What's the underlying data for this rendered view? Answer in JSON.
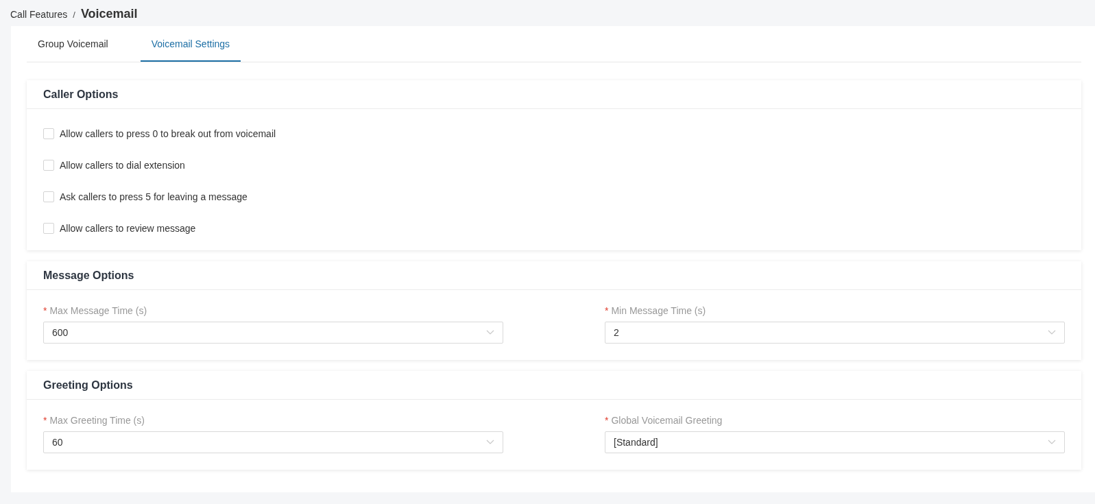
{
  "breadcrumb": {
    "parent": "Call Features",
    "separator": "/",
    "current": "Voicemail"
  },
  "tabs": [
    {
      "label": "Group Voicemail",
      "selected": false
    },
    {
      "label": "Voicemail Settings",
      "selected": true
    }
  ],
  "sections": [
    {
      "title": "Caller Options",
      "kind": "checkboxes",
      "options": [
        {
          "label": "Allow callers to press 0 to break out from voicemail",
          "checked": false
        },
        {
          "label": "Allow callers to dial extension",
          "checked": false
        },
        {
          "label": "Ask callers to press 5 for leaving a message",
          "checked": false
        },
        {
          "label": "Allow callers to review message",
          "checked": false
        }
      ]
    },
    {
      "title": "Message Options",
      "kind": "selects",
      "fields": [
        {
          "required_mark": "*",
          "label": "Max Message Time (s)",
          "value": "600"
        },
        {
          "required_mark": "*",
          "label": "Min Message Time (s)",
          "value": "2"
        }
      ]
    },
    {
      "title": "Greeting Options",
      "kind": "selects",
      "fields": [
        {
          "required_mark": "*",
          "label": "Max Greeting Time (s)",
          "value": "60"
        },
        {
          "required_mark": "*",
          "label": "Global Voicemail Greeting",
          "value": "[Standard]"
        }
      ]
    }
  ]
}
